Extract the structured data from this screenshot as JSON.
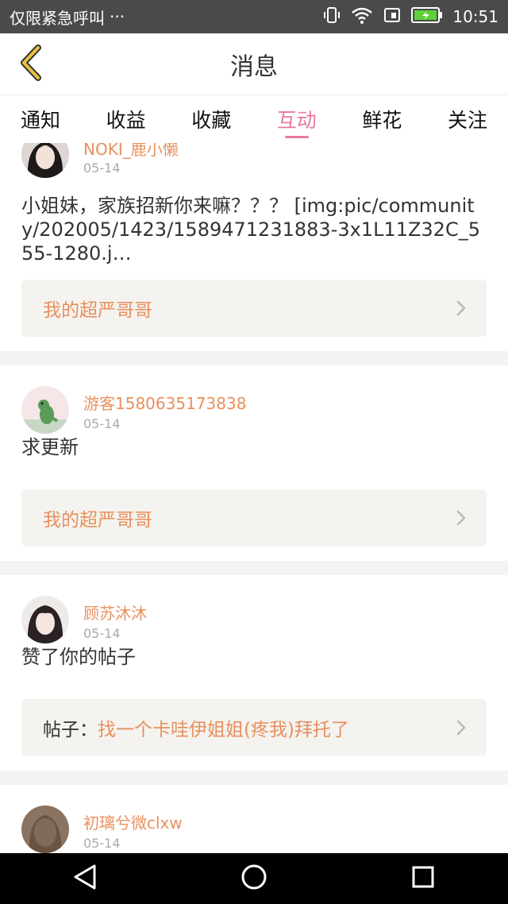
{
  "status_bar": {
    "left_text": "仅限紧急呼叫",
    "more": "···",
    "time": "10:51"
  },
  "header": {
    "title": "消息"
  },
  "tabs": [
    {
      "label": "通知",
      "active": false
    },
    {
      "label": "收益",
      "active": false
    },
    {
      "label": "收藏",
      "active": false
    },
    {
      "label": "互动",
      "active": true
    },
    {
      "label": "鲜花",
      "active": false
    },
    {
      "label": "关注",
      "active": false
    }
  ],
  "messages": [
    {
      "name": "NOKI_鹿小懒",
      "date": "05-14",
      "text": "小姐妹，家族招新你来嘛？？？ [img:pic/community/202005/1423/1589471231883-3x1L11Z32C_555-1280.j…",
      "ref_prefix": "",
      "ref_text": "我的超严哥哥"
    },
    {
      "name": "游客1580635173838",
      "date": "05-14",
      "text": "求更新",
      "ref_prefix": "",
      "ref_text": "我的超严哥哥"
    },
    {
      "name": "顾苏沐沐",
      "date": "05-14",
      "text": "赞了你的帖子",
      "ref_prefix": "帖子：",
      "ref_text": "找一个卡哇伊姐姐(疼我)拜托了"
    },
    {
      "name": "初璃兮微clxw",
      "date": "05-14"
    }
  ],
  "colors": {
    "accent_pink": "#e8789e",
    "name_orange": "#e8905d",
    "back_yellow": "#e5c43c"
  }
}
